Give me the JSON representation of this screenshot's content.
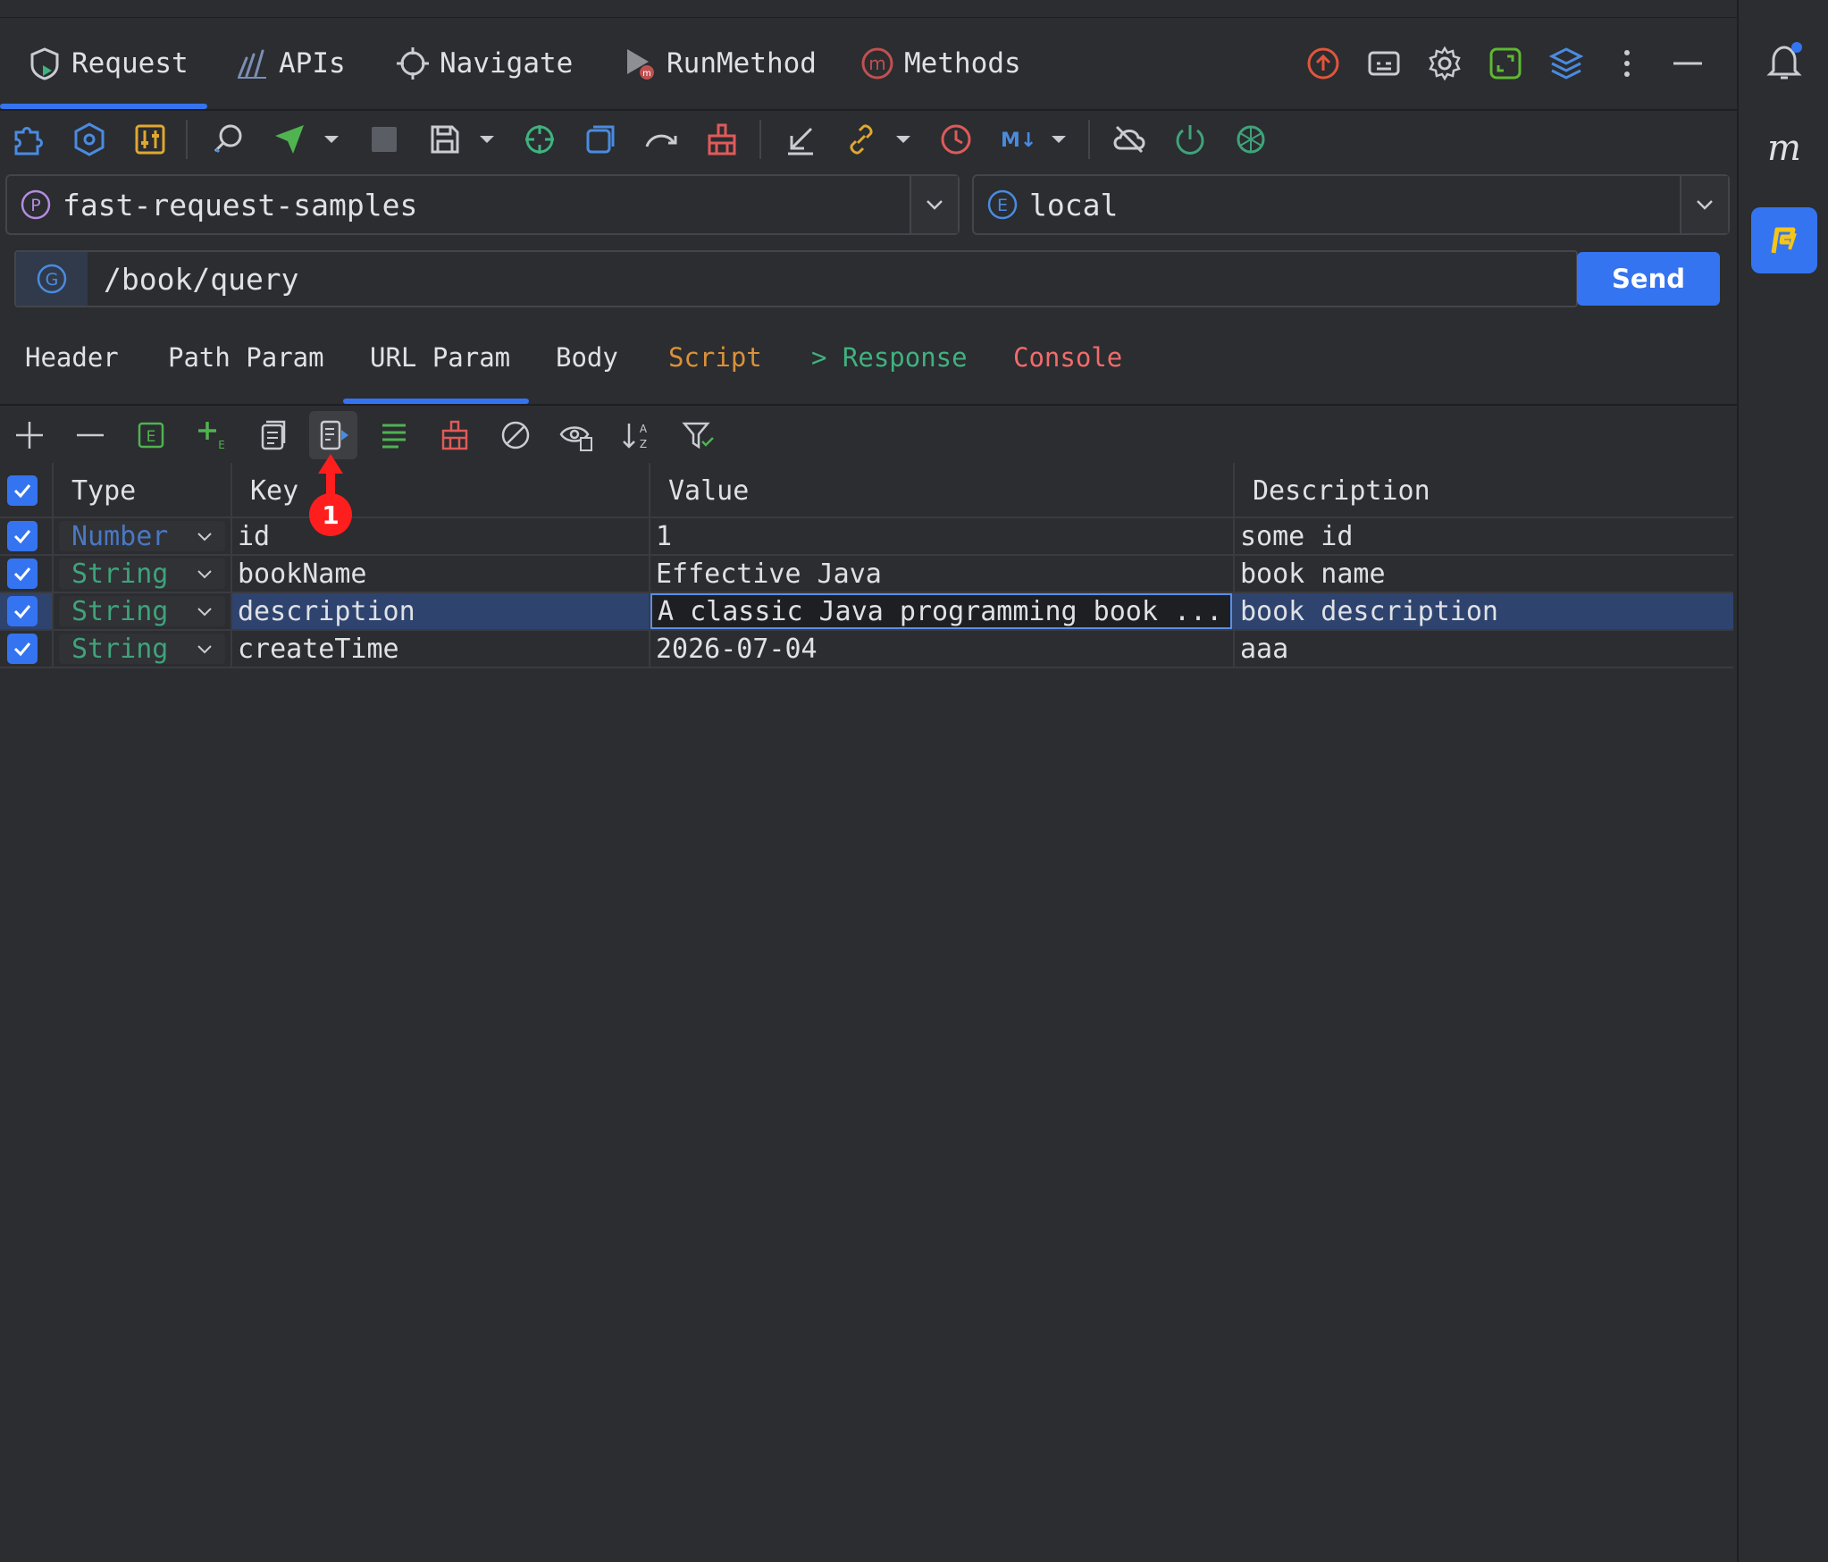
{
  "top_tabs": [
    {
      "label": "Request",
      "icon": "request-icon"
    },
    {
      "label": "APIs",
      "icon": "apis-icon"
    },
    {
      "label": "Navigate",
      "icon": "navigate-icon"
    },
    {
      "label": "RunMethod",
      "icon": "run-method-icon"
    },
    {
      "label": "Methods",
      "icon": "methods-icon"
    }
  ],
  "project_selector": {
    "value": "fast-request-samples",
    "icon": "project-p-icon"
  },
  "env_selector": {
    "value": "local",
    "icon": "environment-e-icon"
  },
  "request": {
    "method_icon": "get-method-icon",
    "url": "/book/query",
    "send_label": "Send"
  },
  "sub_tabs": [
    {
      "label": "Header",
      "color": "#dfe1e5"
    },
    {
      "label": "Path Param",
      "color": "#dfe1e5"
    },
    {
      "label": "URL Param",
      "color": "#dfe1e5",
      "active": true
    },
    {
      "label": "Body",
      "color": "#dfe1e5"
    },
    {
      "label": "Script",
      "color": "#d9913a"
    },
    {
      "label": "> Response",
      "color": "#3fb27f"
    },
    {
      "label": "Console",
      "color": "#f26b6b"
    }
  ],
  "table": {
    "headers": {
      "type": "Type",
      "key": "Key",
      "value": "Value",
      "description": "Description"
    },
    "rows": [
      {
        "checked": true,
        "type": "Number",
        "key": "id",
        "value": "1",
        "description": "some id"
      },
      {
        "checked": true,
        "type": "String",
        "key": "bookName",
        "value": "Effective Java",
        "description": "book name"
      },
      {
        "checked": true,
        "type": "String",
        "key": "description",
        "value": "A classic Java programming book ...",
        "description": "book description",
        "selected": true
      },
      {
        "checked": true,
        "type": "String",
        "key": "createTime",
        "value": "2026-07-04",
        "description": "aaa"
      }
    ]
  },
  "annotation": {
    "number": "1"
  },
  "colors": {
    "accent": "#3574f0",
    "number_type": "#4a78c2",
    "string_type": "#3fa37a",
    "background": "#2b2d30"
  }
}
